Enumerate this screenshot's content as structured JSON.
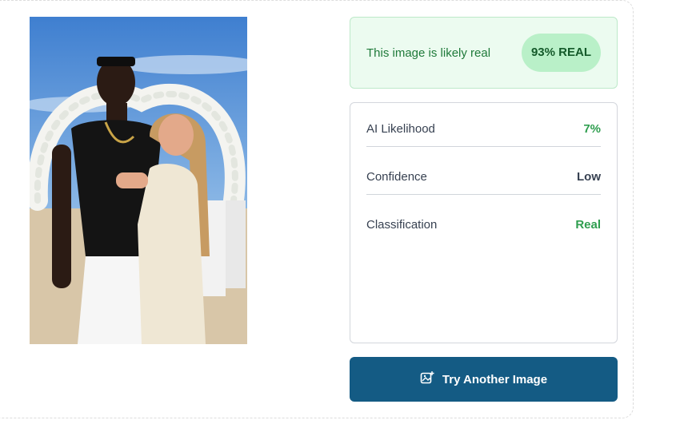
{
  "result": {
    "message": "This image is likely real",
    "badge": "93% REAL"
  },
  "details": [
    {
      "label": "AI Likelihood",
      "value": "7%",
      "color": "#2f9e4f"
    },
    {
      "label": "Confidence",
      "value": "Low",
      "color": "#374151"
    },
    {
      "label": "Classification",
      "value": "Real",
      "color": "#2f9e4f"
    }
  ],
  "action": {
    "button_label": "Try Another Image",
    "icon": "image-sparkle-icon"
  },
  "colors": {
    "accent": "#145b84",
    "success": "#2f9e4f",
    "banner_bg": "#ecfbf0",
    "badge_bg": "#b9f0c8"
  }
}
